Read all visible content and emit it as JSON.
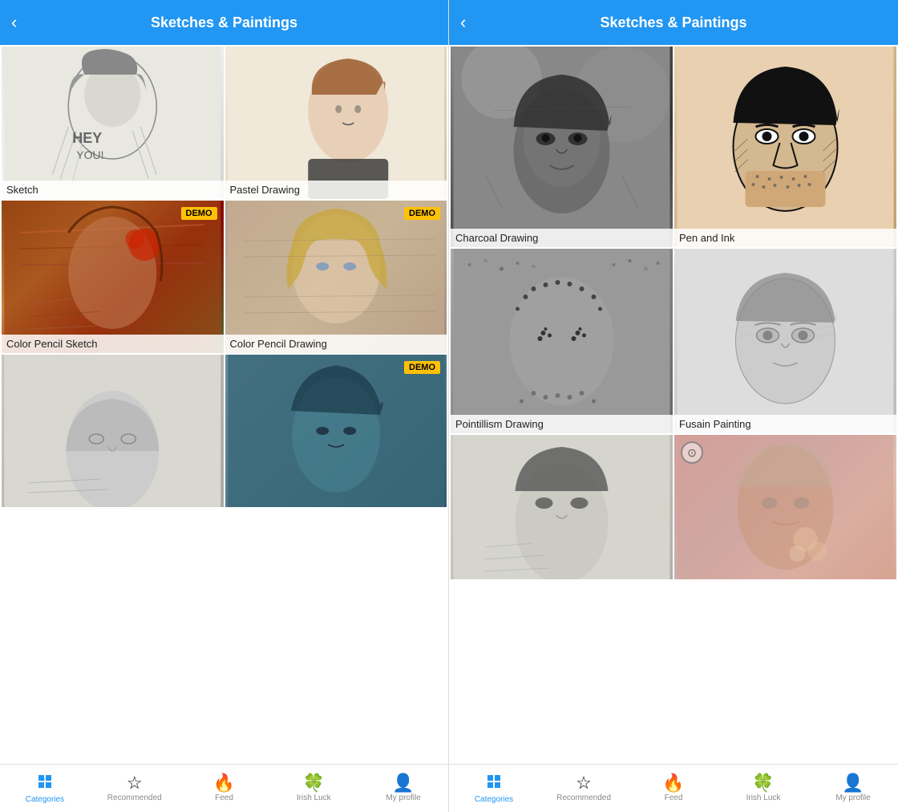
{
  "left_panel": {
    "header": {
      "title": "Sketches & Paintings",
      "back_label": "‹"
    },
    "filters": [
      {
        "id": "sketch",
        "label": "Sketch",
        "demo": false,
        "bg": "sketch-bg"
      },
      {
        "id": "pastel-drawing",
        "label": "Pastel Drawing",
        "demo": false,
        "bg": "pastel-bg"
      },
      {
        "id": "color-pencil-sketch",
        "label": "Color Pencil Sketch",
        "demo": true,
        "bg": "cpencil-bg"
      },
      {
        "id": "color-pencil-drawing",
        "label": "Color Pencil Drawing",
        "demo": true,
        "bg": "cpencil2-bg"
      },
      {
        "id": "item5",
        "label": "",
        "demo": false,
        "bg": "sketch3-bg"
      },
      {
        "id": "item6",
        "label": "",
        "demo": true,
        "bg": "demo3-bg"
      }
    ],
    "nav": {
      "items": [
        {
          "id": "categories",
          "label": "Categories",
          "active": true,
          "icon": "grid-icon"
        },
        {
          "id": "recommended",
          "label": "Recommended",
          "active": false,
          "icon": "star-icon"
        },
        {
          "id": "feed",
          "label": "Feed",
          "active": false,
          "icon": "flame-icon"
        },
        {
          "id": "irish-luck",
          "label": "Irish Luck",
          "active": false,
          "icon": "clover-icon"
        },
        {
          "id": "my-profile",
          "label": "My profile",
          "active": false,
          "icon": "person-icon"
        }
      ]
    }
  },
  "right_panel": {
    "header": {
      "title": "Sketches & Paintings",
      "back_label": "‹"
    },
    "filters": [
      {
        "id": "charcoal",
        "label": "Charcoal Drawing",
        "demo": false,
        "bg": "charcoal-bg",
        "height": "tall"
      },
      {
        "id": "pen-ink",
        "label": "Pen and Ink",
        "demo": false,
        "bg": "pen-ink-bg",
        "height": "medium"
      },
      {
        "id": "pointillism",
        "label": "Pointillism Drawing",
        "demo": false,
        "bg": "pointillism-bg",
        "height": "medium"
      },
      {
        "id": "fusain",
        "label": "Fusain Painting",
        "demo": false,
        "bg": "fusain-bg",
        "height": "medium"
      },
      {
        "id": "sketch-bottom",
        "label": "",
        "demo": false,
        "bg": "sketch4-bg",
        "height": "short"
      },
      {
        "id": "double-exp",
        "label": "",
        "demo": false,
        "bg": "double-exp-bg",
        "height": "medium"
      }
    ],
    "nav": {
      "items": [
        {
          "id": "categories",
          "label": "Categories",
          "active": true,
          "icon": "grid-icon"
        },
        {
          "id": "recommended",
          "label": "Recommended",
          "active": false,
          "icon": "star-icon"
        },
        {
          "id": "feed",
          "label": "Feed",
          "active": false,
          "icon": "flame-icon"
        },
        {
          "id": "irish-luck",
          "label": "Irish Luck",
          "active": false,
          "icon": "clover-icon"
        },
        {
          "id": "my-profile",
          "label": "My profile",
          "active": false,
          "icon": "person-icon"
        }
      ]
    }
  }
}
